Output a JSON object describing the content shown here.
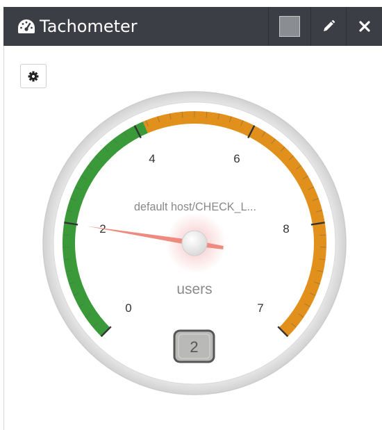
{
  "window": {
    "title": "Tachometer"
  },
  "gauge": {
    "value": 2,
    "value_display": "2",
    "min_label": "0",
    "max_label": "7",
    "major_labels": [
      "2",
      "4",
      "6",
      "8"
    ],
    "ok_until": 4.15,
    "scale_max": 10,
    "series_label": "default host/CHECK_L...",
    "unit": "users",
    "colors": {
      "ok": "#3a9a3a",
      "warning": "#e2901c",
      "needle": "#ef8a80",
      "titlebar": "#3b3f45"
    }
  },
  "icons": {
    "title": "tachometer-icon",
    "edit": "pencil-icon",
    "close": "close-icon",
    "settings": "gear-icon"
  }
}
